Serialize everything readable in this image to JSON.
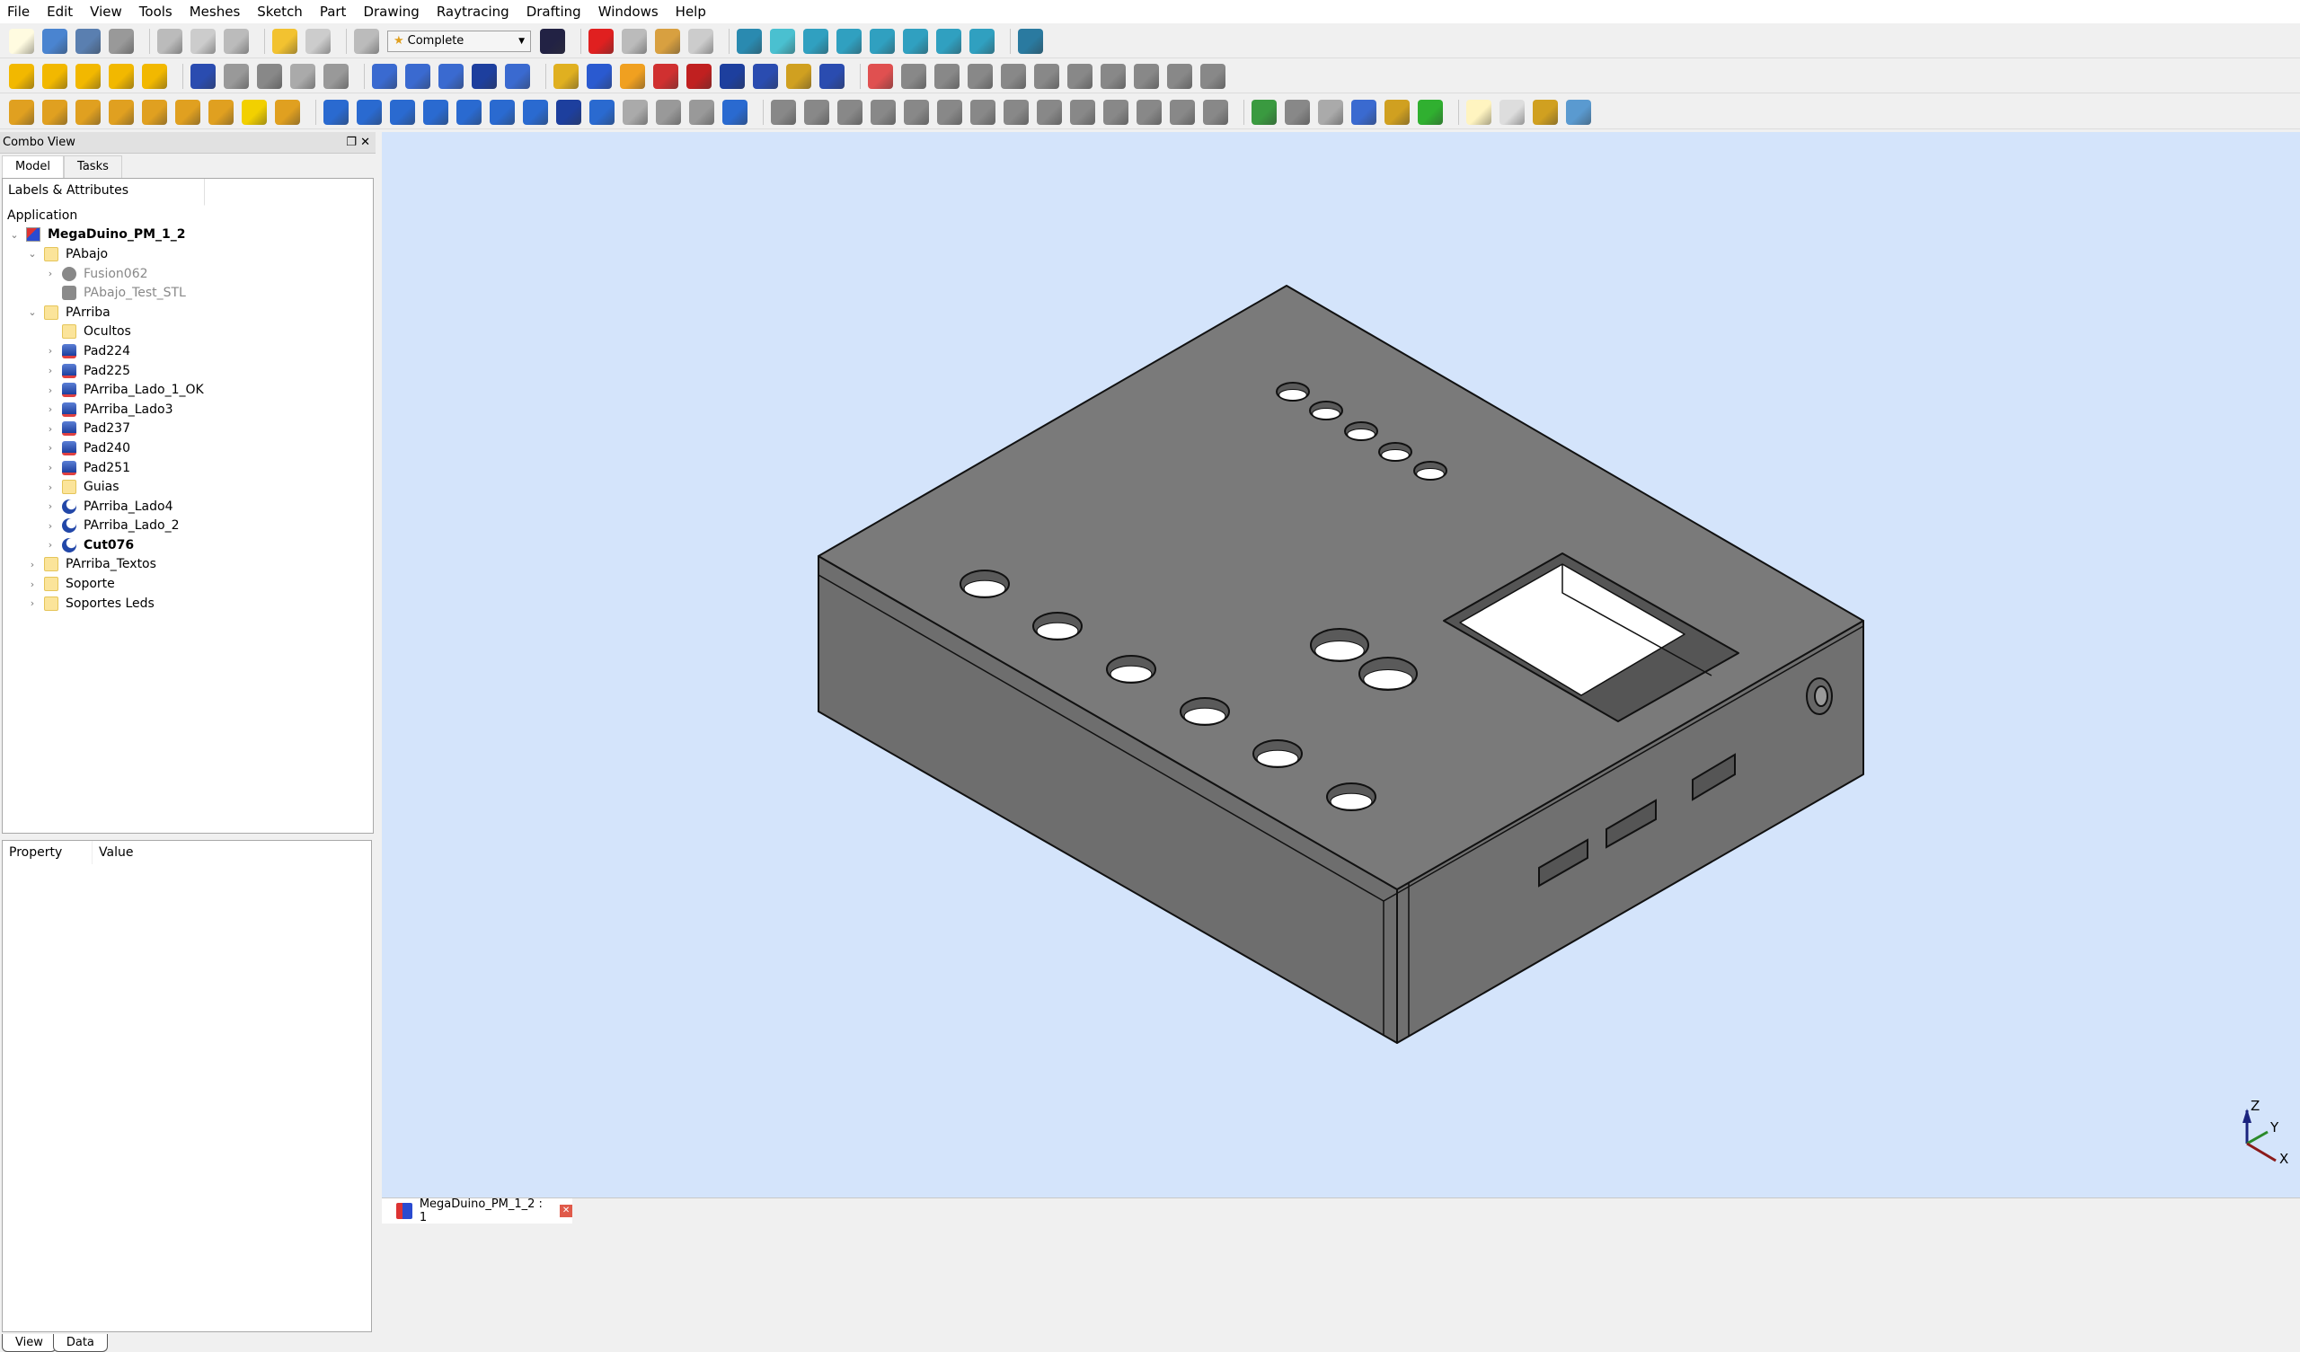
{
  "menu": [
    "File",
    "Edit",
    "View",
    "Tools",
    "Meshes",
    "Sketch",
    "Part",
    "Drawing",
    "Raytracing",
    "Drafting",
    "Windows",
    "Help"
  ],
  "toolbar": {
    "workbench": "Complete",
    "row1": [
      [
        "new-document-icon",
        "#fffbe0"
      ],
      [
        "open-folder-icon",
        "#4a84d0"
      ],
      [
        "save-icon",
        "#5a7fb0"
      ],
      [
        "save-as-icon",
        "#999"
      ],
      "|",
      [
        "cut-icon",
        "#bbb"
      ],
      [
        "copy-icon",
        "#ccc"
      ],
      [
        "paste-icon",
        "#bbb"
      ],
      "|",
      [
        "undo-icon",
        "#f2c230"
      ],
      [
        "redo-icon",
        "#ccc"
      ],
      "|",
      [
        "refresh-icon",
        "#bbb"
      ],
      "WB",
      [
        "whats-this-icon",
        "#224"
      ],
      "|",
      [
        "record-macro-icon",
        "#e02020"
      ],
      [
        "stop-macro-icon",
        "#bbb"
      ],
      [
        "edit-macro-icon",
        "#d8a040"
      ],
      [
        "run-macro-icon",
        "#ccc"
      ],
      "|",
      [
        "fit-all-icon",
        "#2a8ab0"
      ],
      [
        "view-iso-icon",
        "#4ac0d0"
      ],
      [
        "view-front-icon",
        "#30a0c0"
      ],
      [
        "view-top-icon",
        "#30a0c0"
      ],
      [
        "view-right-icon",
        "#30a0c0"
      ],
      [
        "view-rear-icon",
        "#30a0c0"
      ],
      [
        "view-bottom-icon",
        "#30a0c0"
      ],
      [
        "view-left-icon",
        "#30a0c0"
      ],
      "|",
      [
        "measure-icon",
        "#2a7aa0"
      ]
    ],
    "row2": [
      [
        "box-icon",
        "#f2b800"
      ],
      [
        "cylinder-icon",
        "#f2b800"
      ],
      [
        "sphere-icon",
        "#f2b800"
      ],
      [
        "cone-icon",
        "#f2b800"
      ],
      [
        "torus-icon",
        "#f2b800"
      ],
      "|",
      [
        "boolean-icon",
        "#2a4cb0"
      ],
      [
        "cut-boolean-icon",
        "#999"
      ],
      [
        "fuse-icon",
        "#888"
      ],
      [
        "common-icon",
        "#aaa"
      ],
      [
        "shape-icon",
        "#999"
      ],
      "|",
      [
        "extrude-icon",
        "#3a6ad0"
      ],
      [
        "revolve-icon",
        "#3a6ad0"
      ],
      [
        "mirror-icon",
        "#3a6ad0"
      ],
      [
        "fillet-icon",
        "#1d3f9e"
      ],
      [
        "chamfer-icon",
        "#3a6ad0"
      ],
      "|",
      [
        "pad-icon",
        "#e0b020"
      ],
      [
        "pocket-icon",
        "#2a5ad0"
      ],
      [
        "hole-icon",
        "#f0a020"
      ],
      [
        "groove-icon",
        "#d03030"
      ],
      [
        "part-red-icon",
        "#c02020"
      ],
      [
        "part-blue-icon",
        "#1d3f9e"
      ],
      [
        "part-yellow-icon",
        "#2a4cb0"
      ],
      [
        "part-multi-icon",
        "#d0a020"
      ],
      [
        "part-multi2-icon",
        "#2a4cb0"
      ],
      "|",
      [
        "drawing-page-icon",
        "#e05050"
      ],
      [
        "export-icon",
        "#888"
      ],
      [
        "point-icon",
        "#888"
      ],
      [
        "line-icon",
        "#888"
      ],
      [
        "circle-icon",
        "#888"
      ],
      [
        "polyline-icon",
        "#888"
      ],
      [
        "rect-icon",
        "#888"
      ],
      [
        "trim-icon",
        "#888"
      ],
      [
        "scissors-icon",
        "#888"
      ],
      [
        "tool1-icon",
        "#888"
      ],
      [
        "tool2-icon",
        "#888"
      ]
    ],
    "row3": [
      [
        "draft-line-icon",
        "#e0a020"
      ],
      [
        "draft-wire-icon",
        "#e0a020"
      ],
      [
        "draft-circle-icon",
        "#e0a020"
      ],
      [
        "draft-arc-icon",
        "#e0a020"
      ],
      [
        "draft-rect-icon",
        "#e0a020"
      ],
      [
        "draft-polygon-icon",
        "#e0a020"
      ],
      [
        "draft-bspline-icon",
        "#e0a020"
      ],
      [
        "draft-text-icon",
        "#f2d000"
      ],
      [
        "draft-dimension-icon",
        "#e0a020"
      ],
      "|",
      [
        "move-icon",
        "#2a6ad0"
      ],
      [
        "rotate-icon",
        "#2a6ad0"
      ],
      [
        "offset-icon",
        "#2a6ad0"
      ],
      [
        "trimex-icon",
        "#2a6ad0"
      ],
      [
        "upgrade-icon",
        "#2a6ad0"
      ],
      [
        "downgrade-icon",
        "#2a6ad0"
      ],
      [
        "scale-icon",
        "#2a6ad0"
      ],
      [
        "shape2dview-icon",
        "#1d3f9e"
      ],
      [
        "draft2sketch-icon",
        "#2a6ad0"
      ],
      [
        "array-icon",
        "#aaa"
      ],
      [
        "addpoint-icon",
        "#999"
      ],
      [
        "delpoint-icon",
        "#999"
      ],
      [
        "wire2spline-icon",
        "#2a6ad0"
      ],
      "|",
      [
        "snap-point-icon",
        "#888"
      ],
      [
        "snap-arc-icon",
        "#888"
      ],
      [
        "snap-vert-icon",
        "#888"
      ],
      [
        "snap-horiz-icon",
        "#888"
      ],
      [
        "snap-parallel-icon",
        "#888"
      ],
      [
        "snap-perp-icon",
        "#888"
      ],
      [
        "snap-angle-icon",
        "#888"
      ],
      [
        "snap-special-icon",
        "#888"
      ],
      [
        "snap-lock-icon",
        "#888"
      ],
      [
        "snap-dim-icon",
        "#888"
      ],
      [
        "snap-ortho-icon",
        "#888"
      ],
      [
        "snap-ext-icon",
        "#888"
      ],
      [
        "snap-center-icon",
        "#888"
      ],
      [
        "snap-grid-icon",
        "#888"
      ],
      "|",
      [
        "raytrace-icon",
        "#3a9a40"
      ],
      [
        "povray-icon",
        "#888"
      ],
      [
        "lux-icon",
        "#aaa"
      ],
      [
        "render-icon",
        "#3a6ad0"
      ],
      [
        "export-render-icon",
        "#d0a020"
      ],
      [
        "go-icon",
        "#30b030"
      ],
      "|",
      [
        "new-page-icon",
        "#fff4c0"
      ],
      [
        "a3-page-icon",
        "#ddd"
      ],
      [
        "drawing-view-icon",
        "#d0a020"
      ],
      [
        "save-page-icon",
        "#5a9ad0"
      ]
    ]
  },
  "combo": {
    "title": "Combo View",
    "tabs": [
      "Model",
      "Tasks"
    ]
  },
  "tree": {
    "header": "Labels & Attributes",
    "app": "Application",
    "items": [
      {
        "label": "MegaDuino_PM_1_2",
        "level": 0,
        "exp": "v",
        "icon": "document-icon",
        "cls": "docico",
        "style": "bold"
      },
      {
        "label": "PAbajo",
        "level": 1,
        "exp": "v",
        "icon": "folder-icon",
        "cls": "folder"
      },
      {
        "label": "Fusion062",
        "level": 2,
        "exp": ">",
        "icon": "fusion-icon",
        "cls": "fus",
        "style": "grey"
      },
      {
        "label": "PAbajo_Test_STL",
        "level": 2,
        "exp": "",
        "icon": "mesh-icon",
        "cls": "stl",
        "style": "grey"
      },
      {
        "label": "PArriba",
        "level": 1,
        "exp": "v",
        "icon": "folder-icon",
        "cls": "folder"
      },
      {
        "label": "Ocultos",
        "level": 2,
        "exp": "",
        "icon": "folder-icon",
        "cls": "folder",
        "narrow": true
      },
      {
        "label": "Pad224",
        "level": 2,
        "exp": ">",
        "icon": "pad-icon",
        "cls": "pad"
      },
      {
        "label": "Pad225",
        "level": 2,
        "exp": ">",
        "icon": "pad-icon",
        "cls": "pad"
      },
      {
        "label": "PArriba_Lado_1_OK",
        "level": 2,
        "exp": ">",
        "icon": "pad-icon",
        "cls": "pad"
      },
      {
        "label": "PArriba_Lado3",
        "level": 2,
        "exp": ">",
        "icon": "pad-icon",
        "cls": "pad"
      },
      {
        "label": "Pad237",
        "level": 2,
        "exp": ">",
        "icon": "pad-icon",
        "cls": "pad"
      },
      {
        "label": "Pad240",
        "level": 2,
        "exp": ">",
        "icon": "pad-icon",
        "cls": "pad"
      },
      {
        "label": "Pad251",
        "level": 2,
        "exp": ">",
        "icon": "pad-icon",
        "cls": "pad"
      },
      {
        "label": "Guias",
        "level": 2,
        "exp": ">",
        "icon": "folder-icon",
        "cls": "folder",
        "narrow": true
      },
      {
        "label": "PArriba_Lado4",
        "level": 2,
        "exp": ">",
        "icon": "cut-icon",
        "cls": "cut"
      },
      {
        "label": "PArriba_Lado_2",
        "level": 2,
        "exp": ">",
        "icon": "cut-icon",
        "cls": "cut"
      },
      {
        "label": "Cut076",
        "level": 2,
        "exp": ">",
        "icon": "cut-icon",
        "cls": "cut",
        "style": "bold"
      },
      {
        "label": "PArriba_Textos",
        "level": 1,
        "exp": ">",
        "icon": "folder-icon",
        "cls": "folder"
      },
      {
        "label": "Soporte",
        "level": 1,
        "exp": ">",
        "icon": "folder-icon",
        "cls": "folder"
      },
      {
        "label": "Soportes Leds",
        "level": 1,
        "exp": ">",
        "icon": "folder-icon",
        "cls": "folder"
      }
    ]
  },
  "properties": {
    "col_property": "Property",
    "col_value": "Value",
    "tabs": [
      "View",
      "Data"
    ]
  },
  "document_tab": {
    "label": "MegaDuino_PM_1_2 : 1"
  },
  "axis": {
    "x": "X",
    "y": "Y",
    "z": "Z",
    "colors": {
      "x": "#8b1a1a",
      "y": "#2a8a2a",
      "z": "#1a237e"
    }
  },
  "colors": {
    "viewport_bg": "#d4e4fb",
    "model_face": "#7a7a7a"
  }
}
